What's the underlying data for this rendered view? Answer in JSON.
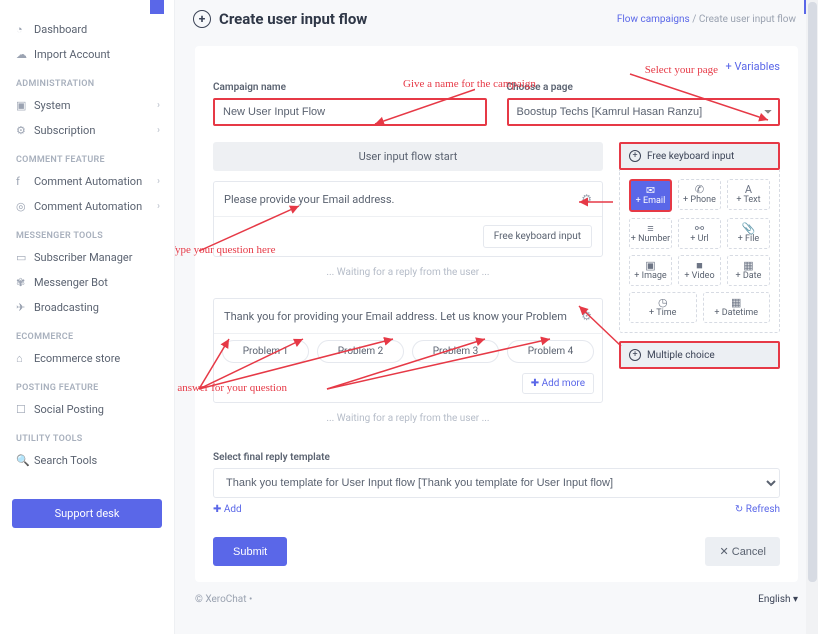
{
  "header": {
    "title": "Create user input flow",
    "breadcrumb_link": "Flow campaigns",
    "breadcrumb_sep": " / ",
    "breadcrumb_current": "Create user input flow"
  },
  "sidebar": {
    "items": [
      {
        "icon": "◔",
        "label": "Dashboard",
        "chev": ""
      },
      {
        "icon": "☁",
        "label": "Import Account",
        "chev": ""
      }
    ],
    "groups": [
      {
        "title": "ADMINISTRATION",
        "items": [
          {
            "icon": "▣",
            "label": "System",
            "chev": "›"
          },
          {
            "icon": "⚙",
            "label": "Subscription",
            "chev": "›"
          }
        ]
      },
      {
        "title": "COMMENT FEATURE",
        "items": [
          {
            "icon": "f",
            "label": "Comment Automation",
            "chev": "›"
          },
          {
            "icon": "◎",
            "label": "Comment Automation",
            "chev": "›"
          }
        ]
      },
      {
        "title": "MESSENGER TOOLS",
        "items": [
          {
            "icon": "▭",
            "label": "Subscriber Manager",
            "chev": ""
          },
          {
            "icon": "✾",
            "label": "Messenger Bot",
            "chev": ""
          },
          {
            "icon": "✈",
            "label": "Broadcasting",
            "chev": ""
          }
        ]
      },
      {
        "title": "ECOMMERCE",
        "items": [
          {
            "icon": "⌂",
            "label": "Ecommerce store",
            "chev": ""
          }
        ]
      },
      {
        "title": "POSTING FEATURE",
        "items": [
          {
            "icon": "☐",
            "label": "Social Posting",
            "chev": ""
          }
        ]
      },
      {
        "title": "UTILITY TOOLS",
        "items": [
          {
            "icon": "🔍",
            "label": "Search Tools",
            "chev": ""
          }
        ]
      }
    ],
    "support": "Support desk"
  },
  "card": {
    "variables": "+ Variables",
    "campaign_label": "Campaign name",
    "campaign_value": "New User Input Flow",
    "page_label": "Choose a page",
    "page_value": "Boostup Techs [Kamrul Hasan Ranzu]",
    "flow_start": "User input flow start",
    "q1": "Please provide your Email address.",
    "reply_badge": "Free keyboard input",
    "wait": "... Waiting for a reply from the user ...",
    "q2": "Thank you for providing your Email address. Let us know your Problem",
    "problems": [
      "Problem 1",
      "Problem 2",
      "Problem 3",
      "Problem 4"
    ],
    "add_more": "Add more",
    "final_label": "Select final reply template",
    "final_value": "Thank you template for User Input flow [Thank you template for User Input flow]",
    "add": "Add",
    "refresh": "Refresh",
    "submit": "Submit",
    "cancel": "Cancel"
  },
  "kb": {
    "head1": "Free keyboard input",
    "head2": "Multiple choice",
    "cells": [
      {
        "icon": "✉",
        "label": "+ Email",
        "active": true
      },
      {
        "icon": "✆",
        "label": "+ Phone"
      },
      {
        "icon": "A",
        "label": "+ Text"
      },
      {
        "icon": "≡",
        "label": "+ Number"
      },
      {
        "icon": "⚯",
        "label": "+ Url"
      },
      {
        "icon": "📎",
        "label": "+ File"
      },
      {
        "icon": "▣",
        "label": "+ Image"
      },
      {
        "icon": "■",
        "label": "+ Video"
      },
      {
        "icon": "▦",
        "label": "+ Date"
      },
      {
        "icon": "◷",
        "label": "+ Time"
      },
      {
        "icon": "▦",
        "label": "+ Datetime"
      }
    ]
  },
  "annotations": {
    "a1": "Give a name for the campaign",
    "a2": "Select your page",
    "a3": "Type your question here",
    "a4": "Create multiple choice answer for your question"
  },
  "footer": {
    "copy": "© XeroChat  •",
    "lang": "English ▾"
  }
}
